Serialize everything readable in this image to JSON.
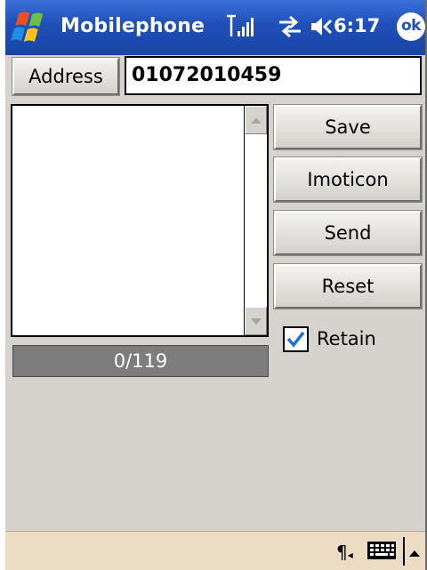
{
  "titlebar": {
    "app_title": "Mobilephone",
    "time": "6:17",
    "ok_label": "ok",
    "icons": [
      "windows-start-icon",
      "signal-icon",
      "sync-icon",
      "speaker-icon"
    ]
  },
  "address": {
    "button_label": "Address",
    "phone_value": "01072010459"
  },
  "message": {
    "value": "",
    "counter": "0/119"
  },
  "actions": {
    "save_label": "Save",
    "imoticon_label": "Imoticon",
    "send_label": "Send",
    "reset_label": "Reset"
  },
  "retain": {
    "label": "Retain",
    "checked": true
  },
  "menubar": {
    "icons": [
      "paragraph-icon",
      "keyboard-icon",
      "sip-up-arrow-icon"
    ]
  },
  "colors": {
    "titlebar": "#1f4fb8",
    "background": "#d6d3ce",
    "menubar": "#eddcc4",
    "counter_bar": "#7d7d7d",
    "check": "#1f6fd8"
  }
}
